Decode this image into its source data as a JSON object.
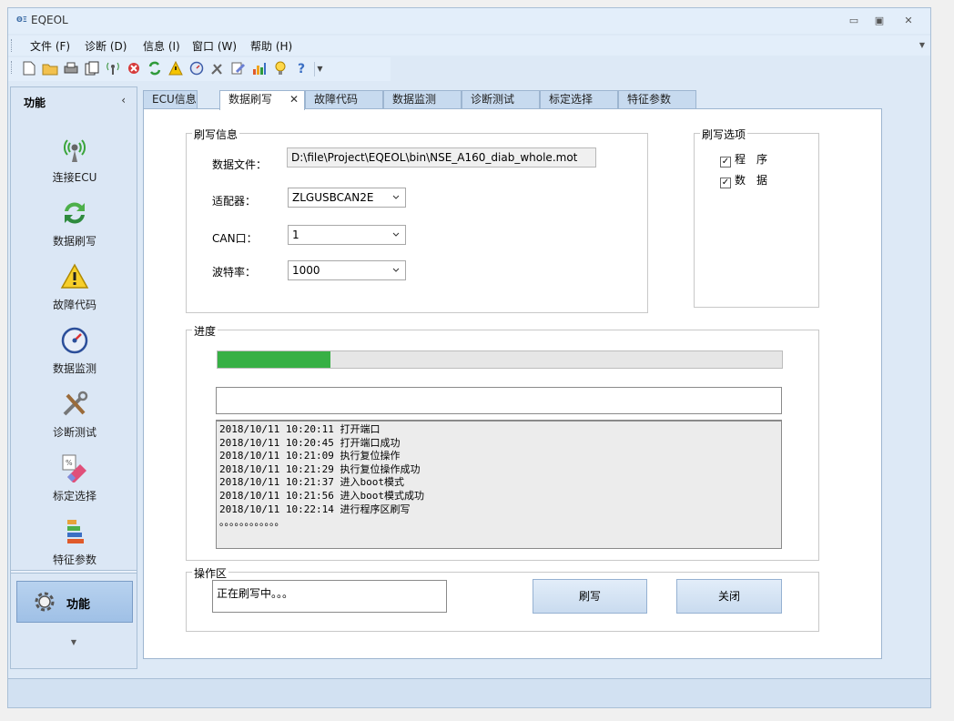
{
  "window": {
    "title": "EQEOL",
    "app_icon": "eqeol-logo-icon"
  },
  "menu": [
    "文件 (F)",
    "诊断 (D)",
    "信息 (I)",
    "窗口 (W)",
    "帮助 (H)"
  ],
  "toolbar": [
    "new-file-icon",
    "open-folder-icon",
    "print-icon",
    "copy-icon",
    "connect-antenna-icon",
    "stop-icon",
    "refresh-icon",
    "warning-icon",
    "gauge-icon",
    "tools-icon",
    "edit-icon",
    "bar-chart-icon",
    "lightbulb-icon",
    "help-icon"
  ],
  "nav": {
    "title": "功能",
    "items": [
      {
        "label": "连接ECU",
        "icon": "antenna-icon"
      },
      {
        "label": "数据刷写",
        "icon": "refresh-arrows-icon"
      },
      {
        "label": "故障代码",
        "icon": "warning-triangle-icon"
      },
      {
        "label": "数据监测",
        "icon": "gauge-icon"
      },
      {
        "label": "诊断测试",
        "icon": "tools-icon"
      },
      {
        "label": "标定选择",
        "icon": "calibration-eraser-icon"
      },
      {
        "label": "特征参数",
        "icon": "stacked-bars-icon"
      }
    ],
    "footer_button": "功能"
  },
  "tabs": [
    {
      "label": "ECU信息",
      "active": false
    },
    {
      "label": "数据刷写",
      "active": true
    },
    {
      "label": "故障代码",
      "active": false
    },
    {
      "label": "数据监测",
      "active": false
    },
    {
      "label": "诊断测试",
      "active": false
    },
    {
      "label": "标定选择",
      "active": false
    },
    {
      "label": "特征参数",
      "active": false
    }
  ],
  "flash_info": {
    "title": "刷写信息",
    "data_file_label": "数据文件：",
    "data_file_value": "D:\\file\\Project\\EQEOL\\bin\\NSE_A160_diab_whole.mot",
    "adapter_label": "适配器：",
    "adapter_value": "ZLGUSBCAN2E",
    "can_label": "CAN口：",
    "can_value": "1",
    "baud_label": "波特率：",
    "baud_value": "1000"
  },
  "flash_options": {
    "title": "刷写选项",
    "options": [
      {
        "label": "程　序",
        "checked": true
      },
      {
        "label": "数　据",
        "checked": true
      }
    ]
  },
  "progress": {
    "title": "进度",
    "fraction": 0.2,
    "log": [
      "2018/10/11 10:20:11 打开端口",
      "2018/10/11 10:20:45 打开端口成功",
      "2018/10/11 10:21:09 执行复位操作",
      "2018/10/11 10:21:29 执行复位操作成功",
      "2018/10/11 10:21:37 进入boot模式",
      "2018/10/11 10:21:56 进入boot模式成功",
      "2018/10/11 10:22:14 进行程序区刷写",
      "。。。。。。。。。。。。"
    ]
  },
  "operation": {
    "title": "操作区",
    "status": "正在刷写中。。。",
    "flash_button": "刷写",
    "close_button": "关闭"
  },
  "colors": {
    "progress": "#37b045",
    "chrome": "#dde9f6"
  }
}
